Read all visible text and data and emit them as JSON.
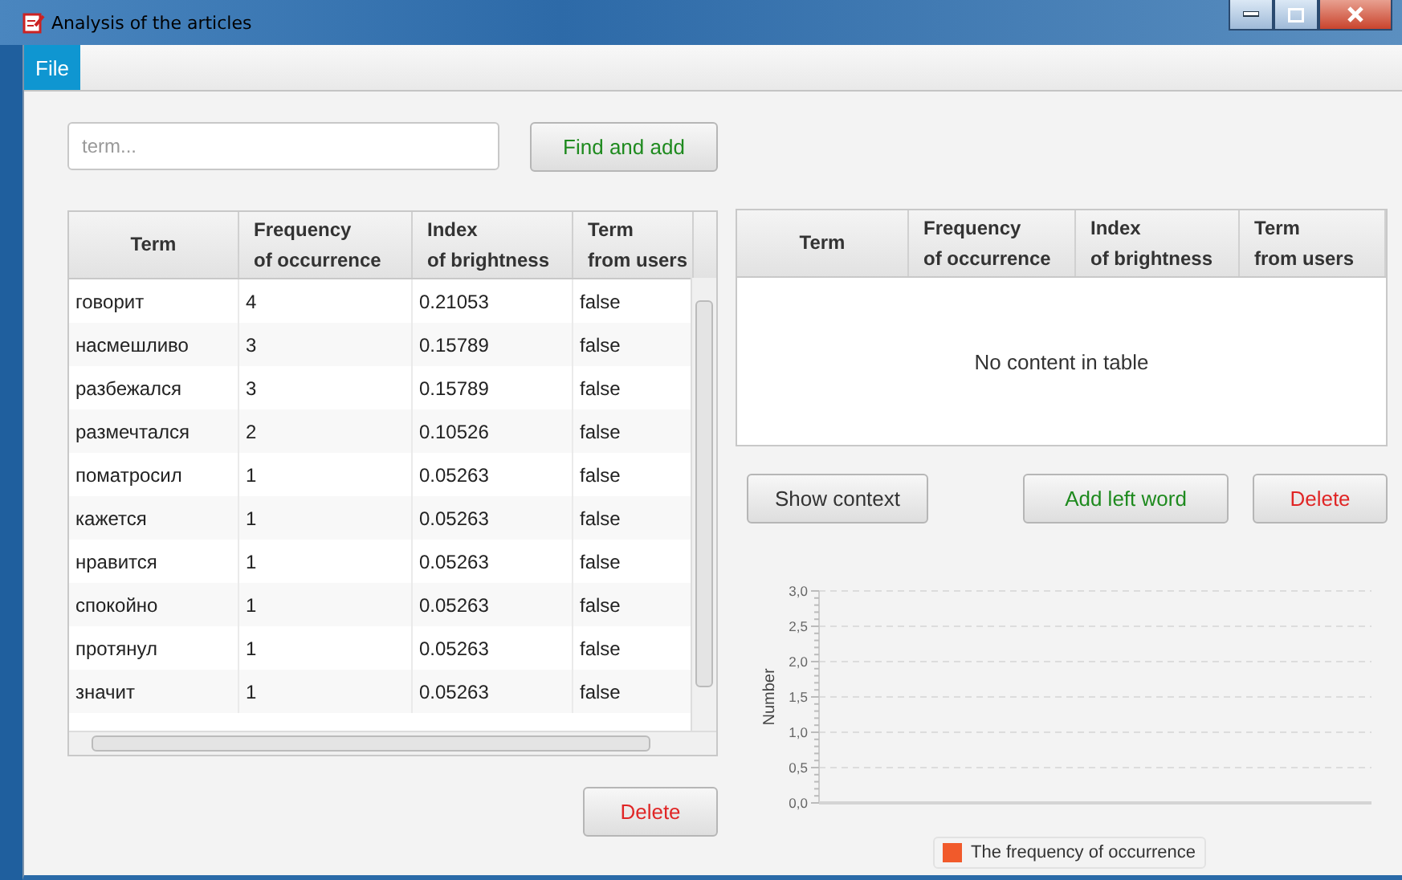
{
  "window": {
    "title": "Analysis of the articles"
  },
  "menu": [
    {
      "label": "File",
      "selected": true
    }
  ],
  "search": {
    "placeholder": "term..."
  },
  "find_button": "Find and add",
  "terms_table": {
    "columns": [
      "Term",
      "Frequency\nof occurrence",
      "Index\nof brightness",
      "Term\nfrom users"
    ],
    "rows": [
      [
        "говорит",
        "4",
        "0.21053",
        "false"
      ],
      [
        "насмешливо",
        "3",
        "0.15789",
        "false"
      ],
      [
        "разбежался",
        "3",
        "0.15789",
        "false"
      ],
      [
        "размечтался",
        "2",
        "0.10526",
        "false"
      ],
      [
        "поматросил",
        "1",
        "0.05263",
        "false"
      ],
      [
        "кажется",
        "1",
        "0.05263",
        "false"
      ],
      [
        "нравится",
        "1",
        "0.05263",
        "false"
      ],
      [
        "спокойно",
        "1",
        "0.05263",
        "false"
      ],
      [
        "протянул",
        "1",
        "0.05263",
        "false"
      ],
      [
        "значит",
        "1",
        "0.05263",
        "false"
      ]
    ]
  },
  "left_delete_button": "Delete",
  "selected_table": {
    "columns": [
      "Term",
      "Frequency\nof occurrence",
      "Index\nof brightness",
      "Term\nfrom users"
    ],
    "placeholder": "No content in table"
  },
  "actions": [
    {
      "label": "Show context",
      "kind": "neutral"
    },
    {
      "label": "Add left word",
      "kind": "add"
    },
    {
      "label": "Delete",
      "kind": "danger"
    }
  ],
  "chart": {
    "chart_data": {
      "type": "bar",
      "grid": true,
      "ylabel": "Number",
      "ylim": [
        0,
        3
      ],
      "yticks": [
        {
          "value": 0,
          "label": "0,0"
        },
        {
          "value": 0.5,
          "label": "0,5"
        },
        {
          "value": 1,
          "label": "1,0"
        },
        {
          "value": 1.5,
          "label": "1,5"
        },
        {
          "value": 2,
          "label": "2,0"
        },
        {
          "value": 2.5,
          "label": "2,5"
        },
        {
          "value": 3,
          "label": "3,0"
        }
      ],
      "series": [
        {
          "name": "The frequency of occurrence",
          "color": "#f15a2b"
        }
      ]
    }
  }
}
